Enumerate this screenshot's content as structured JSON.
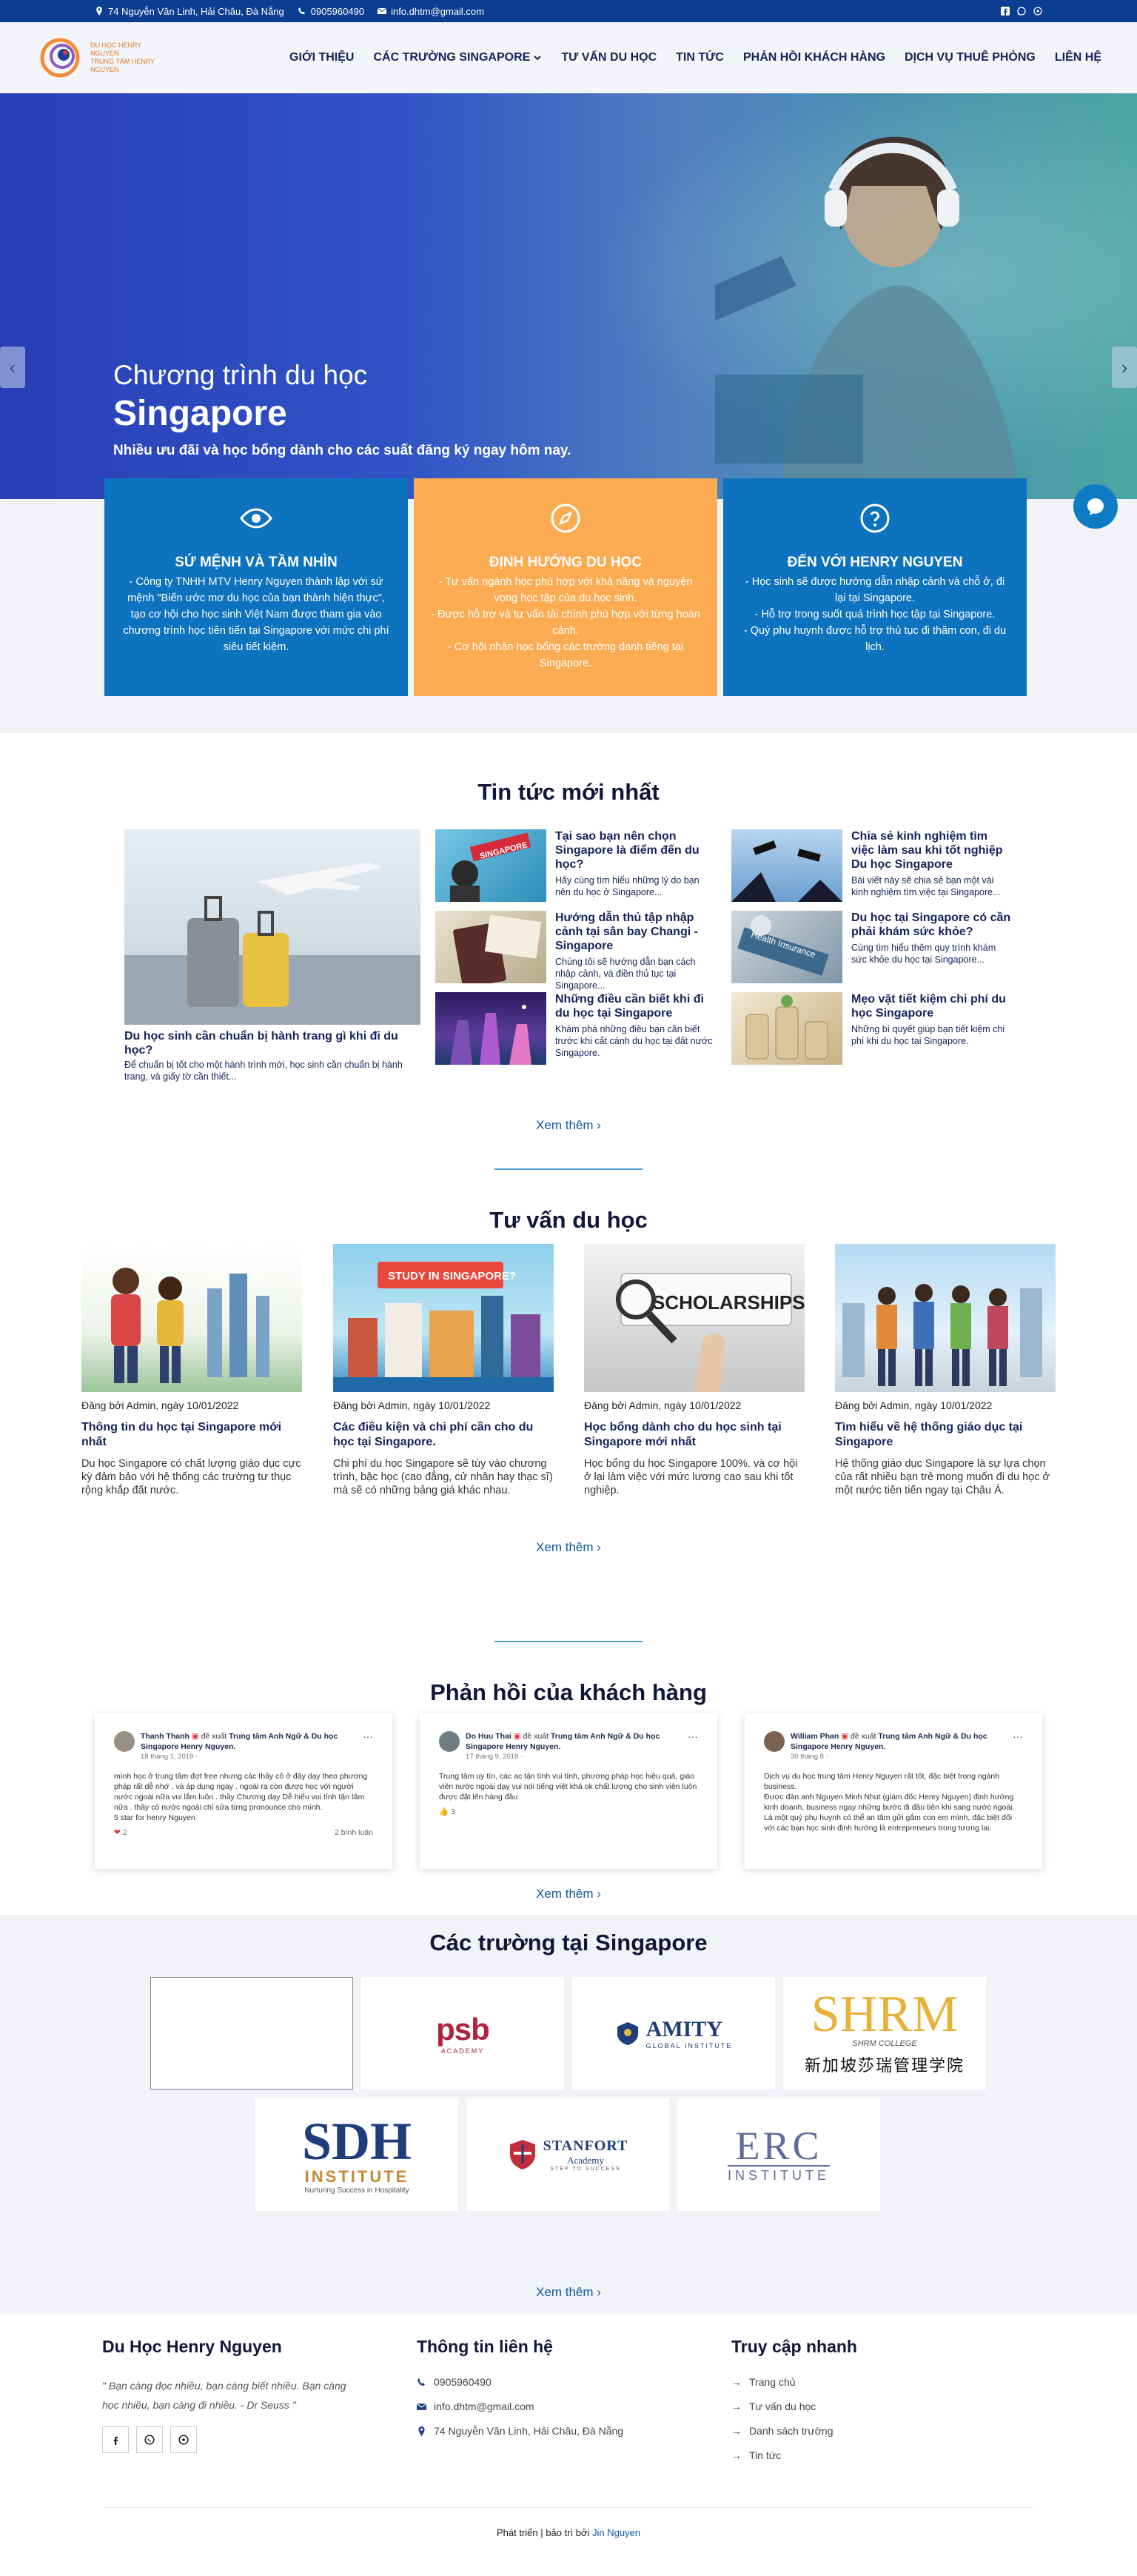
{
  "topbar": {
    "address": "74 Nguyễn Văn Linh, Hải Châu, Đà Nẵng",
    "phone": "0905960490",
    "email": "info.dhtm@gmail.com"
  },
  "logo": {
    "line1": "DU HỌC HENRY NGUYEN",
    "line2": "TRUNG TÂM HENRY NGUYEN"
  },
  "nav": {
    "items": [
      "GIỚI THIỆU",
      "CÁC TRƯỜNG SINGAPORE",
      "TƯ VẤN DU HỌC",
      "TIN TỨC",
      "PHẢN HỒI KHÁCH HÀNG",
      "DỊCH VỤ THUÊ PHÒNG",
      "LIÊN HỆ"
    ]
  },
  "hero": {
    "title1": "Chương trình du học",
    "title2": "Singapore",
    "subtitle": "Nhiều ưu đãi và học bổng dành cho các suất đăng ký ngay hôm nay.",
    "prev": "‹",
    "next": "›"
  },
  "features": [
    {
      "title": "SỨ MỆNH VÀ TẦM NHÌN",
      "text": "- Công ty TNHH MTV Henry Nguyen thành lập với sứ mệnh \"Biến ước mơ du học của bạn thành hiện thực\", tạo cơ hội cho học sinh Việt Nam được tham gia vào chương trình học tiên tiến tại Singapore với mức chi phí siêu tiết kiệm.",
      "color": "#0e73bf",
      "icon": "eye-icon"
    },
    {
      "title": "ĐỊNH HƯỚNG DU HỌC",
      "text": "- Tư vấn ngành học phù hợp với khả năng và nguyện vọng học tập của du học sinh.\n- Được hỗ trợ và tư vấn tài chính phù hợp với từng hoàn cảnh.\n- Cơ hội nhận học bổng các trường danh tiếng tại Singapore.",
      "color": "#fbac52",
      "icon": "compass-icon"
    },
    {
      "title": "ĐẾN VỚI HENRY NGUYEN",
      "text": "- Học sinh sẽ được hướng dẫn nhập cảnh và chỗ ở, đi lại tại Singapore.\n- Hỗ trợ trong suốt quá trình học tập tại Singapore.\n- Quý phụ huynh được hỗ trợ thủ tục đi thăm con, đi du lịch.",
      "color": "#0e73bf",
      "icon": "question-icon"
    }
  ],
  "news": {
    "title": "Tin tức mới nhất",
    "big": {
      "title": "Du học sinh cần chuẩn bị hành trang gì khi đi du học?",
      "desc": "Để chuẩn bị tốt cho một hành trình mới, học sinh cần chuẩn bị hành trang, và giấy tờ cần thiết..."
    },
    "items": [
      {
        "title": "Tại sao bạn nên chọn Singapore là điểm đến du học?",
        "desc": "Hãy cùng tìm hiểu những lý do bạn nên du học ở Singapore..."
      },
      {
        "title": "Hướng dẫn thủ tập nhập cảnh tại sân bay Changi - Singapore",
        "desc": "Chúng tôi sẽ hướng dẫn bạn cách nhập cảnh, và điền thủ tục tại Singapore..."
      },
      {
        "title": "Những điều cần biết khi đi du học tại Singapore",
        "desc": "Khám phá những điều bạn cần biết trước khi cất cánh du học tại đất nước Singapore."
      },
      {
        "title": "Chia sẻ kinh nghiệm tìm việc làm sau khi tốt nghiệp Du học Singapore",
        "desc": "Bài viết này sẽ chia sẻ bạn một vài kinh nghiệm tìm việc tại Singapore..."
      },
      {
        "title": "Du học tại Singapore có cần phải khám sức khỏe?",
        "desc": "Cùng tìm hiểu thêm quy trình khám sức khỏe du học tại Singapore..."
      },
      {
        "title": "Mẹo vặt tiết kiệm chi phí du học Singapore",
        "desc": "Những bí quyết giúp bạn tiết kiệm chi phí khi du học tại Singapore."
      }
    ],
    "more": "Xem thêm ›",
    "thumb_label": "SINGAPORE",
    "insurance_label": "Health Insurance"
  },
  "consult": {
    "title": "Tư vấn du học",
    "cards": [
      {
        "meta": "Đăng bởi Admin, ngày 10/01/2022",
        "title": "Thông tin du học tại Singapore mới nhất",
        "desc": "Du học Singapore có chất lượng giáo dục cực kỳ đảm bảo với hệ thống các trường tư thục rộng khắp đất nước."
      },
      {
        "meta": "Đăng bởi Admin, ngày 10/01/2022",
        "title": "Các điều kiện và chi phí cần cho du học tại Singapore.",
        "desc": "Chi phí du học Singapore sẽ tùy vào chương trình, bậc học (cao đẳng, cử nhân hay thạc sĩ) mà sẽ có những bảng giá khác nhau."
      },
      {
        "meta": "Đăng bởi Admin, ngày 10/01/2022",
        "title": "Học bổng dành cho du học sinh tại Singapore mới nhất",
        "desc": "Học bổng du học Singapore 100%. và cơ hội ở lại làm việc với mức lương cao sau khi tốt nghiệp."
      },
      {
        "meta": "Đăng bởi Admin, ngày 10/01/2022",
        "title": "Tìm hiểu về hệ thống giáo dục tại Singapore",
        "desc": "Hệ thống giáo dục Singapore là sự lựa chọn của rất nhiều bạn trẻ mong muốn đi du học ở một nước tiên tiến ngay tại Châu Á."
      }
    ],
    "img2_label": "STUDY IN SINGAPORE?",
    "img3_label": "SCHOLARSHIPS",
    "more": "Xem thêm ›"
  },
  "feedback": {
    "title": "Phản hồi của khách hàng",
    "posts": [
      {
        "name": "Thanh Thanh",
        "rec": "đề xuất",
        "target": "Trung tâm Anh Ngữ & Du học Singapore Henry Nguyen.",
        "date": "18 tháng 1, 2019 · ",
        "body": "mình học ở trung tâm đợt free nhưng các thầy cô ở đây dạy theo phương pháp rất dễ nhớ , và áp dụng ngay . ngoài ra còn được học với người nước ngoài nữa vui lắm luôn . thầy Chương dạy Dễ hiểu vui tính tận tâm nữa . thầy cô nước ngoài chỉ sửa từng pronounce cho mình.\n5 star for henry Nguyen",
        "reacts": "2",
        "comments": "2 bình luận"
      },
      {
        "name": "Do Huu Thai",
        "rec": "đề xuất",
        "target": "Trung tâm Anh Ngữ & Du học Singapore Henry Nguyen.",
        "date": "17 tháng 9, 2018 · ",
        "body": "Trung tâm uy tín, các ac tận tình vui tính, phương pháp học hiệu quả, giáo viên nước ngoài dạy vui nói tiếng việt khá ok chất lượng cho sinh viên luôn được đặt lên hàng đầu",
        "reacts": "3",
        "comments": ""
      },
      {
        "name": "William Phan",
        "rec": "đề xuất",
        "target": "Trung tâm Anh Ngữ & Du học Singapore Henry Nguyen.",
        "date": "30 tháng 8 · ",
        "body": "Dịch vụ du học trung tâm Henry Nguyen rất tốt, đặc biệt trong ngành business.\nĐược đàn anh Nguyen Minh Nhut (giám đốc Henry Nguyen) định hướng kinh doanh, business ngay những bước đi đầu tiên khi sang nước ngoài.\nLà một quý phụ huynh có thể an tâm gửi gắm con em mình, đặc biệt đối với các bạn học sinh định hướng là entrepreneurs trong tương lai.",
        "reacts": "",
        "comments": ""
      }
    ],
    "more": "Xem thêm ›"
  },
  "schools": {
    "title": "Các trường tại Singapore",
    "logos": [
      {
        "name": "",
        "sub": ""
      },
      {
        "name": "psb",
        "sub": "ACADEMY"
      },
      {
        "name": "AMITY",
        "sub": "GLOBAL INSTITUTE"
      },
      {
        "name": "SHRM",
        "sub": "SHRM COLLEGE",
        "cn": "新加坡莎瑞管理学院"
      },
      {
        "name": "SDH",
        "sub": "INSTITUTE",
        "tag": "Nurturing Success in Hospitality"
      },
      {
        "name": "STANFORT",
        "sub": "Academy",
        "tag": "STEP TO SUCCESS"
      },
      {
        "name": "ERC",
        "sub": "INSTITUTE"
      }
    ],
    "more": "Xem thêm ›"
  },
  "footer": {
    "col1_title": "Du Học Henry Nguyen",
    "quote": "\" Bạn càng đọc nhiều, bạn càng biết nhiều. Bạn càng học nhiều, bạn càng đi nhiều. - Dr Seuss \"",
    "col2_title": "Thông tin liên hệ",
    "phone": "0905960490",
    "email": "info.dhtm@gmail.com",
    "address": "74 Nguyễn Văn Linh, Hải Châu, Đà Nẵng",
    "col3_title": "Truy cập nhanh",
    "links": [
      "Trang chủ",
      "Tư vấn du học",
      "Danh sách trường",
      "Tin tức"
    ],
    "copy_prefix": "Phát triển | bảo trì bởi",
    "copy_link": "Jin Nguyen"
  }
}
